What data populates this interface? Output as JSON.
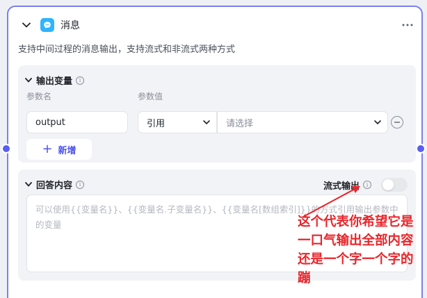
{
  "node": {
    "title": "消息",
    "description": "支持中间过程的消息输出，支持流式和非流式两种方式",
    "more_label": "⋯"
  },
  "output_vars": {
    "title": "输出变量",
    "info": "i",
    "col_name": "参数名",
    "col_value": "参数值",
    "name_value": "output",
    "ref_type": "引用",
    "value_placeholder": "请选择",
    "add_label": "新增"
  },
  "answer": {
    "title": "回答内容",
    "info": "i",
    "stream_label": "流式输出",
    "stream_info": "i",
    "stream_enabled": false,
    "placeholder": "可以使用{{变量名}}、{{变量名.子变量名}}、{{变量名[数组索引]}}的方式引用输出参数中的变量"
  },
  "annotation": {
    "text": "这个代表你希望它是一口气输出全部内容还是一个字一个字的蹦"
  },
  "colors": {
    "accent": "#4d53e8",
    "border": "#7b7ef2",
    "annotation": "#e8262b",
    "icon": "#2fb3ff"
  }
}
